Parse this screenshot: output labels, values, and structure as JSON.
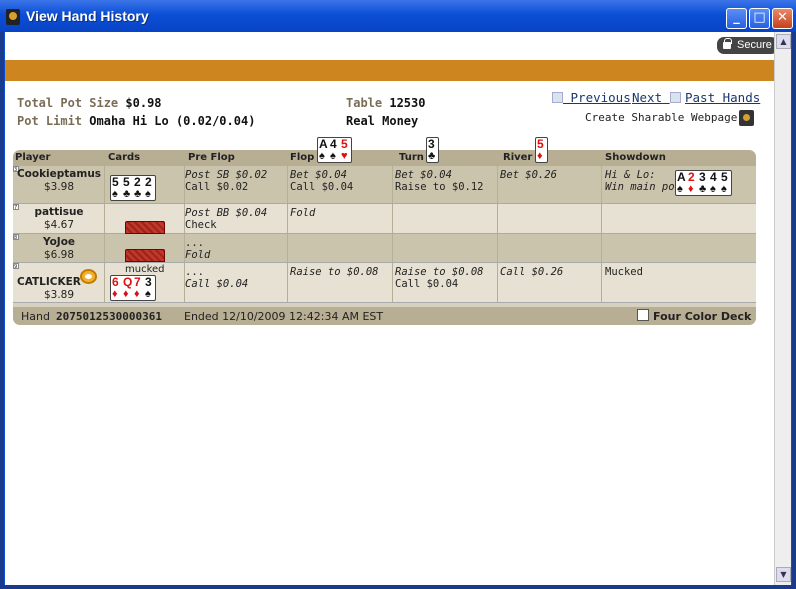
{
  "window": {
    "title": "View Hand History",
    "minimize_label": "_",
    "maximize_label": "□",
    "close_label": "✕"
  },
  "secure": {
    "label": "Secure"
  },
  "info": {
    "total_pot_label": "Total Pot Size",
    "total_pot_value": "$0.98",
    "pot_limit_label": "Pot Limit",
    "game_value": "Omaha Hi Lo (0.02/0.04)",
    "table_label": "Table",
    "table_value": "12530",
    "money_value": "Real Money"
  },
  "nav": {
    "previous": "Previous",
    "next": "Next",
    "past_hands": "Past Hands",
    "share": "Create Sharable Webpage"
  },
  "table": {
    "headers": {
      "player": "Player",
      "cards": "Cards",
      "preflop": "Pre Flop",
      "flop": "Flop",
      "turn": "Turn",
      "river": "River",
      "showdown": "Showdown"
    },
    "board": {
      "flop": [
        {
          "rank": "A",
          "suit": "♠",
          "color": "blk"
        },
        {
          "rank": "4",
          "suit": "♠",
          "color": "blk"
        },
        {
          "rank": "5",
          "suit": "♥",
          "color": "red"
        }
      ],
      "turn": [
        {
          "rank": "3",
          "suit": "♣",
          "color": "blk"
        }
      ],
      "river": [
        {
          "rank": "5",
          "suit": "♦",
          "color": "red"
        }
      ]
    },
    "rows": [
      {
        "seat": "3",
        "name": "Cookieptamus",
        "stack": "$3.98",
        "cards": [
          {
            "rank": "5",
            "suit": "♠",
            "color": "blk"
          },
          {
            "rank": "5",
            "suit": "♣",
            "color": "blk"
          },
          {
            "rank": "2",
            "suit": "♣",
            "color": "blk"
          },
          {
            "rank": "2",
            "suit": "♠",
            "color": "blk"
          }
        ],
        "preflop": [
          "Post SB $0.02",
          "Call $0.02"
        ],
        "flop": [
          "Bet $0.04",
          "Call $0.04"
        ],
        "turn": [
          "Bet $0.04",
          "Raise to $0.12"
        ],
        "river": [
          "Bet $0.26"
        ],
        "showdown": [
          "Hi & Lo:",
          "Win main pot"
        ],
        "best_hand": [
          {
            "rank": "A",
            "suit": "♠",
            "color": "blk"
          },
          {
            "rank": "2",
            "suit": "♦",
            "color": "red"
          },
          {
            "rank": "3",
            "suit": "♣",
            "color": "blk"
          },
          {
            "rank": "4",
            "suit": "♠",
            "color": "blk"
          },
          {
            "rank": "5",
            "suit": "♠",
            "color": "blk"
          }
        ]
      },
      {
        "seat": "7",
        "name": "pattisue",
        "stack": "$4.67",
        "preflop": [
          "Post BB $0.04",
          "Check"
        ],
        "flop": [
          "Fold"
        ]
      },
      {
        "seat": "8",
        "name": "YoJoe",
        "stack": "$6.98",
        "preflop": [
          "...",
          "Fold"
        ]
      },
      {
        "seat": "9",
        "name": "CATLICKER",
        "stack": "$3.89",
        "mucked": "mucked",
        "cards": [
          {
            "rank": "6",
            "suit": "♦",
            "color": "red"
          },
          {
            "rank": "Q",
            "suit": "♦",
            "color": "red"
          },
          {
            "rank": "7",
            "suit": "♦",
            "color": "red"
          },
          {
            "rank": "3",
            "suit": "♠",
            "color": "blk"
          }
        ],
        "preflop": [
          "...",
          "Call $0.04"
        ],
        "flop": [
          "Raise to $0.08"
        ],
        "turn": [
          "Raise to $0.08",
          "Call $0.04"
        ],
        "river": [
          "Call $0.26"
        ],
        "showdown": [
          "Mucked"
        ]
      }
    ]
  },
  "footer": {
    "hand_label": "Hand",
    "hand_id": "2075012530000361",
    "ended": "Ended 12/10/2009 12:42:34 AM EST",
    "four_color": "Four Color Deck"
  }
}
